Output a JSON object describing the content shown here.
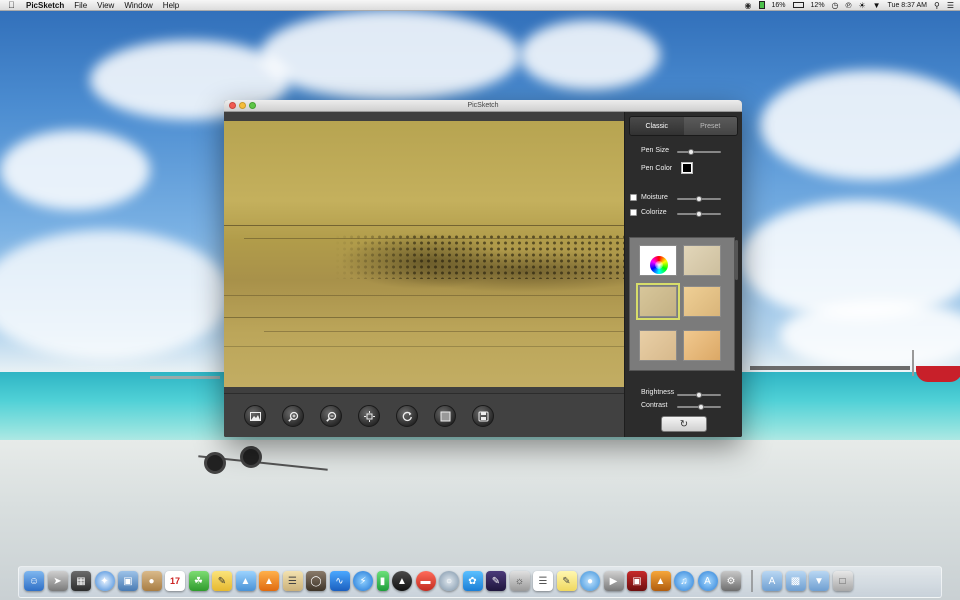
{
  "menubar": {
    "app_name": "PicSketch",
    "menus": [
      "File",
      "View",
      "Window",
      "Help"
    ],
    "battery_left": "16%",
    "battery_right": "12%",
    "clock": "Tue 8:37 AM"
  },
  "window": {
    "title": "PicSketch"
  },
  "panel": {
    "tabs": {
      "classic": "Classic",
      "preset": "Preset"
    },
    "active_tab": "Classic",
    "pen_size_label": "Pen Size",
    "pen_size_value": 0.3,
    "pen_color_label": "Pen Color",
    "pen_color": "#000000",
    "moisture_label": "Moisture",
    "moisture_value": 0.5,
    "moisture_checked": false,
    "colorize_label": "Colorize",
    "colorize_value": 0.5,
    "colorize_checked": false,
    "brightness_label": "Brightness",
    "brightness_value": 0.5,
    "contrast_label": "Contrast",
    "contrast_value": 0.55
  },
  "colors": {
    "selection_highlight": "#d7dd6a",
    "canvas_paper": "#b7a451"
  },
  "toolbar": {
    "buttons": [
      "open-image-icon",
      "zoom-in-icon",
      "zoom-out-icon",
      "fit-icon",
      "rotate-icon",
      "frame-icon",
      "save-icon"
    ]
  }
}
